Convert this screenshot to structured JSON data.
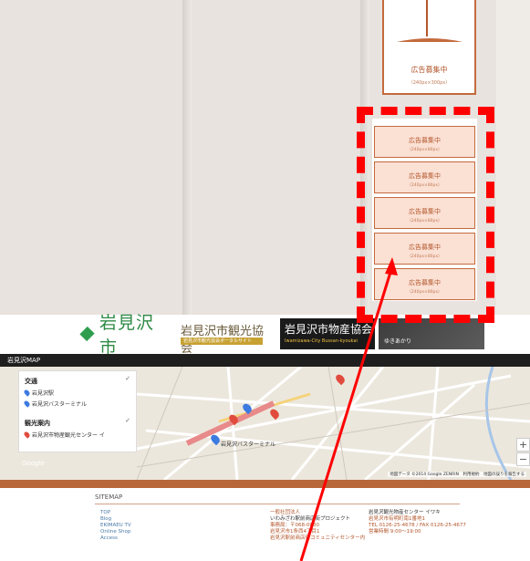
{
  "ads": {
    "big": {
      "title": "広告募集中",
      "size": "（240px×300px）"
    },
    "small": [
      {
        "title": "広告募集中",
        "size": "（240px×80px）"
      },
      {
        "title": "広告募集中",
        "size": "（240px×80px）"
      },
      {
        "title": "広告募集中",
        "size": "（240px×80px）"
      },
      {
        "title": "広告募集中",
        "size": "（240px×80px）"
      },
      {
        "title": "広告募集中",
        "size": "（240px×80px）"
      }
    ]
  },
  "banners": {
    "city": "岩見沢市",
    "tourism": {
      "name": "岩見沢市観光協会",
      "sub": "岩見沢市観光協会ポータルサイト"
    },
    "products": {
      "name": "岩見沢市物産協会",
      "sub": "Iwamizawa-City Bussan-kyoukai"
    },
    "dark": "ゆきあかり"
  },
  "map": {
    "header": "岩見沢MAP",
    "legend": {
      "transport": "交通",
      "transport_items": [
        "岩見沢駅",
        "岩見沢バスターミナル"
      ],
      "tourism": "観光案内",
      "tourism_items": [
        "岩見沢市物産観光センター イ"
      ]
    },
    "labels": {
      "bus_terminal": "岩見沢バスターミナル",
      "logo": "Google",
      "credit": "地図データ ©2014 Google ZENRIN　利用規約　地図の誤りを報告する",
      "zoom_in": "+",
      "zoom_out": "−"
    },
    "pin_colors": {
      "blue": "#3d7be0",
      "red": "#e04b3d"
    }
  },
  "footer": {
    "sitemap": "SITEMAP",
    "nav": [
      "TOP",
      "Blog",
      "EKIMAEU TV",
      "Online Shop",
      "Access"
    ],
    "org": {
      "line1": "一般社団法人",
      "line2": "いわみざわ駅前商店街プロジェクト",
      "line3": "事務局：〒068-0030",
      "line4": "岩見沢市1条西4丁目1",
      "line5": "岩見沢駅前商店街コミュニティセンター内"
    },
    "center": {
      "line1": "岩見沢観光物産センター イワキ",
      "line2": "岩見沢市有明町南1番地1",
      "line3": "TEL 0126-25-4678 / FAX 0126-25-4677",
      "line4": "営業時間 9:00〜19:00"
    }
  },
  "colors": {
    "accent": "#b8673a",
    "highlight": "#ff0000",
    "ad_fill": "#fbe0d4"
  }
}
